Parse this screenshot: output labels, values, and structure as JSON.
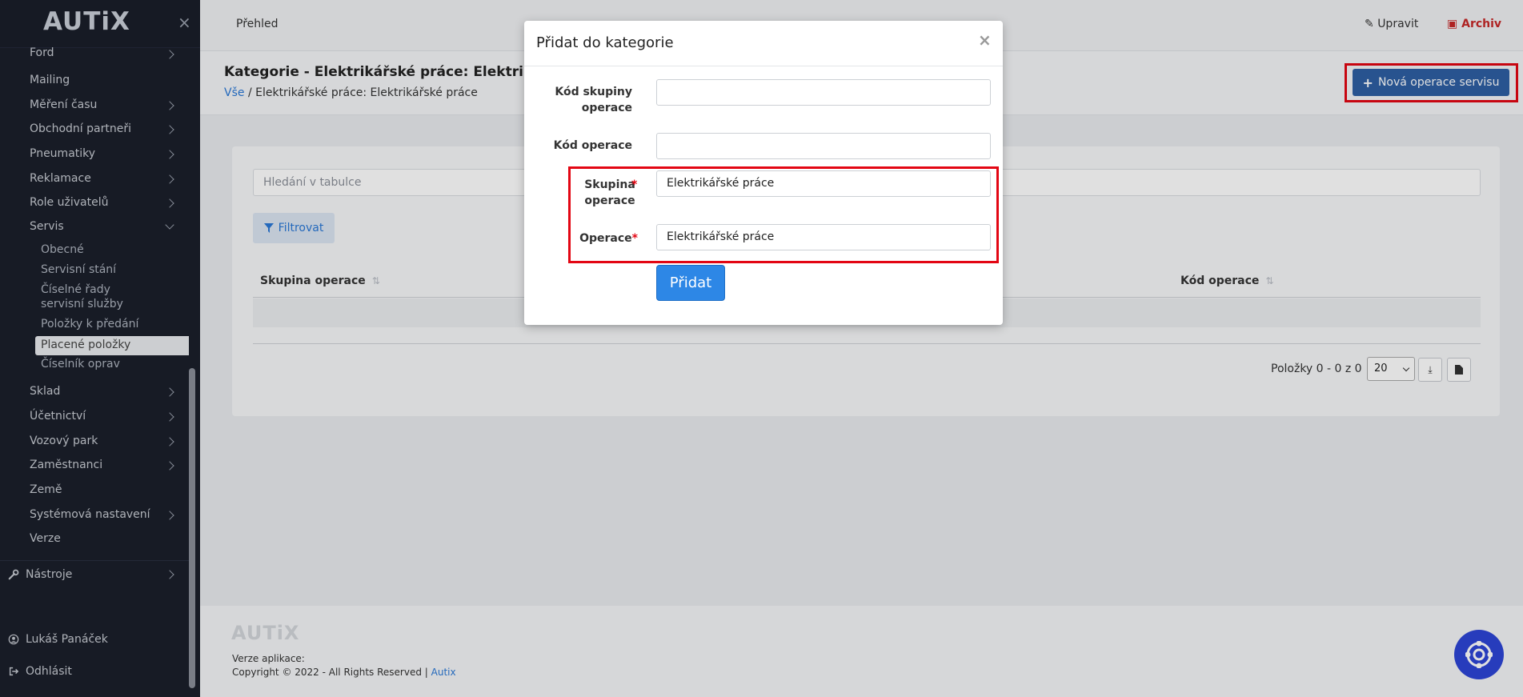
{
  "sidebar": {
    "logo": "AUTiX",
    "close_icon": "×",
    "items": [
      {
        "label": "Ford",
        "has_children": true
      },
      {
        "label": "Mailing",
        "has_children": false
      },
      {
        "label": "Měření času",
        "has_children": true
      },
      {
        "label": "Obchodní partneři",
        "has_children": true
      },
      {
        "label": "Pneumatiky",
        "has_children": true
      },
      {
        "label": "Reklamace",
        "has_children": true
      },
      {
        "label": "Role uživatelů",
        "has_children": true
      },
      {
        "label": "Servis",
        "has_children": true,
        "expanded": true
      },
      {
        "label": "Sklad",
        "has_children": true
      },
      {
        "label": "Účetnictví",
        "has_children": true
      },
      {
        "label": "Vozový park",
        "has_children": true
      },
      {
        "label": "Zaměstnanci",
        "has_children": true
      },
      {
        "label": "Země",
        "has_children": false
      },
      {
        "label": "Systémová nastavení",
        "has_children": true
      },
      {
        "label": "Verze",
        "has_children": false
      }
    ],
    "servis_children": [
      {
        "label": "Obecné"
      },
      {
        "label": "Servisní stání"
      },
      {
        "label": "Číselné řady servisní služby"
      },
      {
        "label": "Položky k předání"
      },
      {
        "label": "Placené položky",
        "active": true
      },
      {
        "label": "Číselník oprav"
      }
    ],
    "tools": "Nástroje",
    "user": "Lukáš Panáček",
    "logout": "Odhlásit"
  },
  "topbar": {
    "overview": "Přehled",
    "edit": "Upravit",
    "archive": "Archiv"
  },
  "page": {
    "title": "Kategorie - Elektrikářské práce: Elektrikářské práce",
    "breadcrumb_root": "Vše",
    "breadcrumb_sep": "/",
    "breadcrumb_current": "Elektrikářské práce: Elektrikářské práce",
    "new_button": "Nová operace servisu"
  },
  "table": {
    "search_placeholder": "Hledání v tabulce",
    "filter_button": "Filtrovat",
    "columns": [
      "Skupina operace",
      "Kód operace"
    ],
    "rows": [],
    "pager_text": "Položky 0 - 0 z 0",
    "page_size": "20"
  },
  "footer": {
    "logo": "AUTiX",
    "version_label": "Verze aplikace:",
    "copyright": "Copyright © 2022 - All Rights Reserved |",
    "copyright_link": "Autix"
  },
  "modal": {
    "title": "Přidat do kategorie",
    "close": "×",
    "fields": [
      {
        "label": "Kód skupiny operace",
        "value": "",
        "required": false
      },
      {
        "label": "Kód operace",
        "value": "",
        "required": false
      },
      {
        "label": "Skupina operace",
        "value": "Elektrikářské práce",
        "required": true
      },
      {
        "label": "Operace",
        "value": "Elektrikářské práce",
        "required": true
      }
    ],
    "submit": "Přidat"
  },
  "colors": {
    "highlight": "#e30613",
    "primary": "#2d87e6",
    "sidebar_bg": "#1b1f2b",
    "archive": "#c62828"
  }
}
